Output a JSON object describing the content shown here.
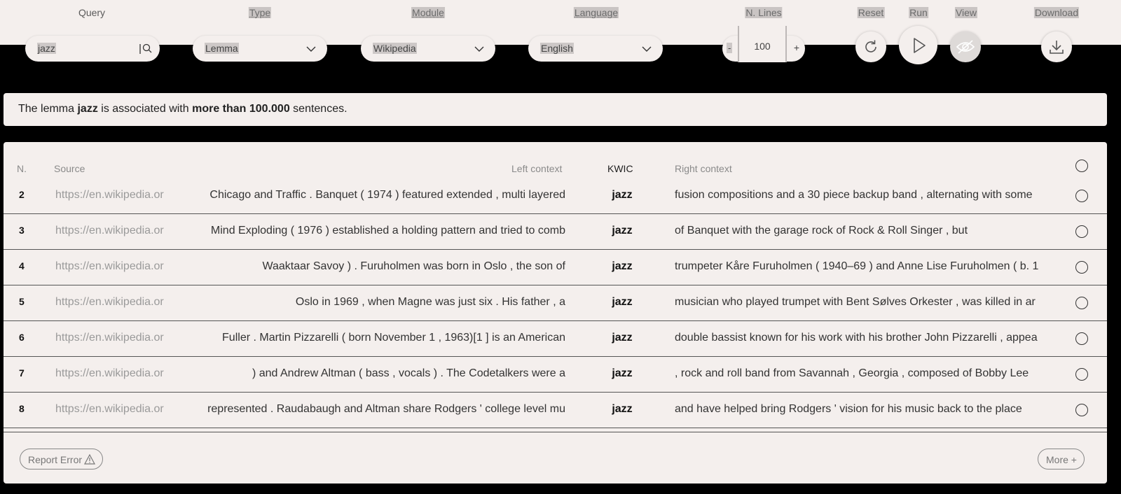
{
  "toolbar": {
    "query": {
      "label": "Query",
      "value": "jazz"
    },
    "type": {
      "label": "Type",
      "value": "Lemma"
    },
    "module": {
      "label": "Module",
      "value": "Wikipedia"
    },
    "language": {
      "label": "Language",
      "value": "English"
    },
    "nlines": {
      "label": "N. Lines",
      "value": "100",
      "minus": "-",
      "plus": "+"
    },
    "reset_label": "Reset",
    "run_label": "Run",
    "view_label": "View",
    "download_label": "Download"
  },
  "banner": {
    "prefix": "The lemma ",
    "lemma": "jazz",
    "middle": " is associated with ",
    "count": "more than 100.000",
    "suffix": " sentences."
  },
  "table": {
    "headers": {
      "n": "N.",
      "source": "Source",
      "left": "Left context",
      "kwic": "KWIC",
      "right": "Right context"
    },
    "rows": [
      {
        "n": "2",
        "source": "https://en.wikipedia.org",
        "left": "Chicago and Traffic . Banquet ( 1974 ) featured extended , multi layered",
        "kwic": "jazz",
        "right": "fusion compositions and a 30 piece backup band , alternating with some"
      },
      {
        "n": "3",
        "source": "https://en.wikipedia.org",
        "left": "Mind Exploding ( 1976 ) established a holding pattern and tried to comb",
        "kwic": "jazz",
        "right": "of Banquet with the garage rock of Rock & Roll Singer , but"
      },
      {
        "n": "4",
        "source": "https://en.wikipedia.org",
        "left": "Waaktaar Savoy ) . Furuholmen was born in Oslo , the son of",
        "kwic": "jazz",
        "right": "trumpeter Kåre Furuholmen ( 1940–69 ) and Anne Lise Furuholmen ( b. 1"
      },
      {
        "n": "5",
        "source": "https://en.wikipedia.org",
        "left": "Oslo in 1969 , when Magne was just six . His father , a",
        "kwic": "jazz",
        "right": "musician who played trumpet with Bent Sølves Orkester , was killed in ar"
      },
      {
        "n": "6",
        "source": "https://en.wikipedia.org",
        "left": "Fuller . Martin Pizzarelli ( born November 1 , 1963)[1 ] is an American",
        "kwic": "jazz",
        "right": "double bassist known for his work with his brother John Pizzarelli , appea"
      },
      {
        "n": "7",
        "source": "https://en.wikipedia.org",
        "left": ") and Andrew Altman ( bass , vocals ) . The Codetalkers were a",
        "kwic": "jazz",
        "right": ", rock and roll band from Savannah , Georgia , composed of Bobby Lee"
      },
      {
        "n": "8",
        "source": "https://en.wikipedia.org",
        "left": "represented . Raudabaugh and Altman share Rodgers ' college level mu",
        "kwic": "jazz",
        "right": "and have helped bring Rodgers ' vision for his music back to the place"
      }
    ]
  },
  "footer": {
    "report_label": "Report Error",
    "more_label": "More +"
  },
  "icons": [
    "search-icon",
    "chevron-down-icon",
    "reset-icon",
    "play-icon",
    "eye-off-icon",
    "download-icon",
    "warning-icon",
    "radio-circle-icon"
  ]
}
